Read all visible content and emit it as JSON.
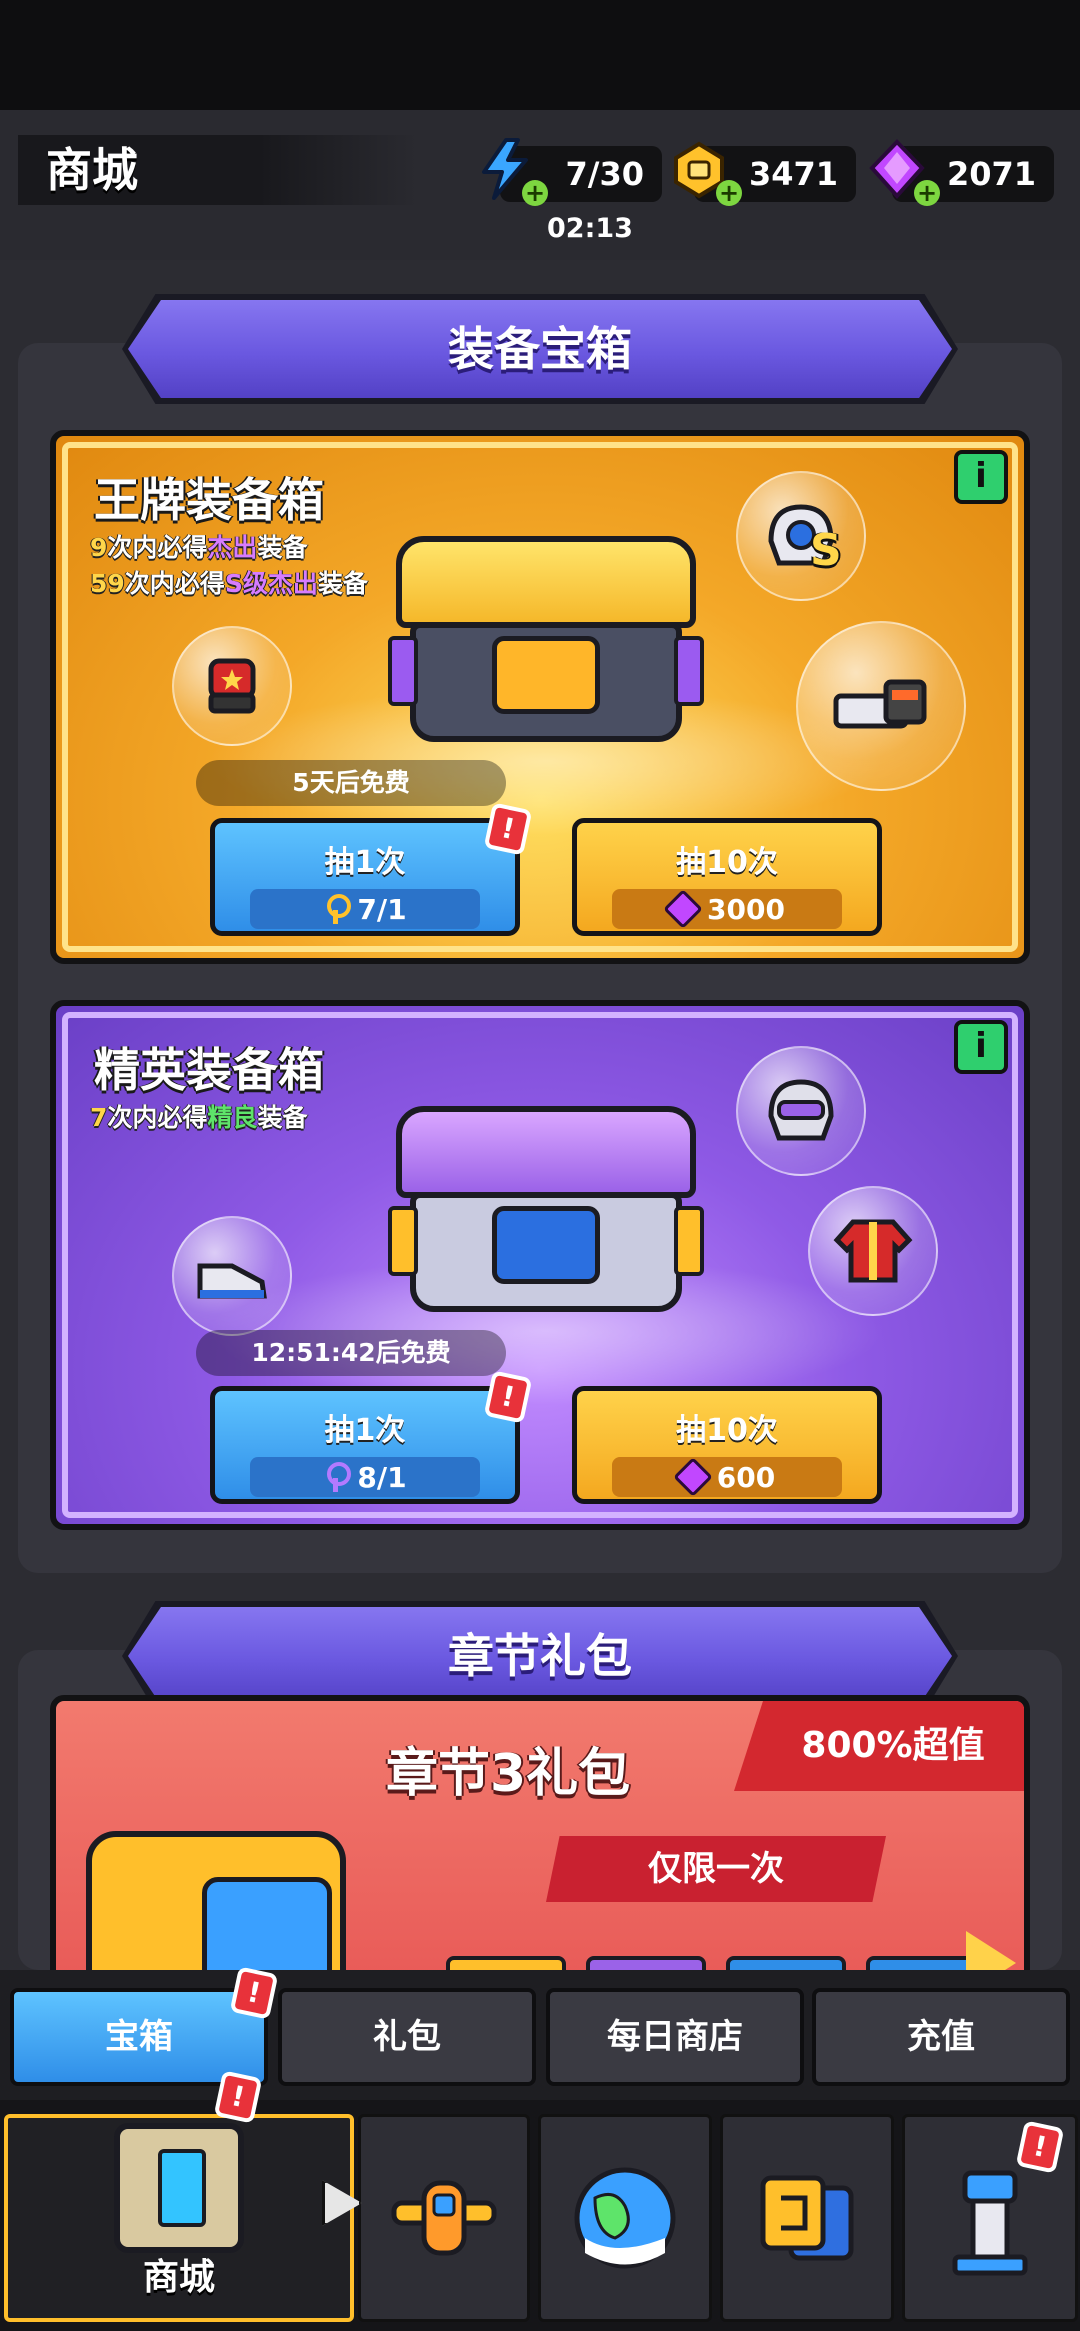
{
  "header": {
    "title": "商城",
    "energy": "7/30",
    "energy_timer": "02:13",
    "coins": "3471",
    "gems": "2071"
  },
  "sections": {
    "equipment_chest": "装备宝箱",
    "chapter_pack": "章节礼包"
  },
  "ace_chest": {
    "title": "王牌装备箱",
    "line1_num": "9",
    "line1_a": "次内必得",
    "line1_b": "杰出",
    "line1_c": "装备",
    "line2_num": "59",
    "line2_a": "次内必得",
    "line2_b": "S级杰出",
    "line2_c": "装备",
    "badge": "S",
    "free_text": "5天后免费",
    "draw1_label": "抽1次",
    "draw1_cost": "7/1",
    "draw10_label": "抽10次",
    "draw10_cost": "3000"
  },
  "elite_chest": {
    "title": "精英装备箱",
    "line1_num": "7",
    "line1_a": "次内必得",
    "line1_b": "精良",
    "line1_c": "装备",
    "free_text": "12:51:42后免费",
    "draw1_label": "抽1次",
    "draw1_cost": "8/1",
    "draw10_label": "抽10次",
    "draw10_cost": "600"
  },
  "chapter_pack": {
    "title": "章节3礼包",
    "value_tag": "800%超值",
    "once": "仅限一次"
  },
  "tabs": [
    "宝箱",
    "礼包",
    "每日商店",
    "充值"
  ],
  "nav": {
    "store_label": "商城"
  },
  "alert_mark": "!",
  "colors": {
    "gold": "#f4a828",
    "purple": "#8f5ae6",
    "banner": "#6a58e0",
    "blue_button": "#2f8ee8",
    "alert": "#e8323a"
  }
}
